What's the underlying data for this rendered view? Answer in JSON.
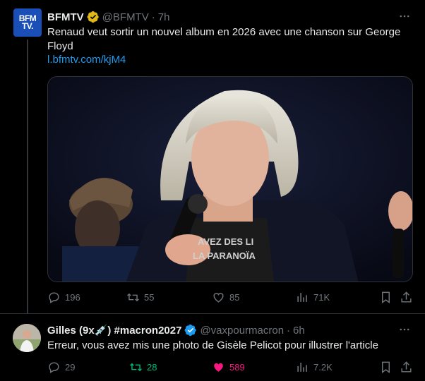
{
  "tweet1": {
    "author_name": "BFMTV",
    "handle": "@BFMTV",
    "separator": "·",
    "time": "7h",
    "avatar_text_line1": "BFM",
    "avatar_text_line2": "TV.",
    "text": "Renaud veut sortir un nouvel album en 2026 avec une chanson sur George Floyd",
    "link": "l.bfmtv.com/kjM4",
    "media_shirt_text_line1": "AVEZ DES LI",
    "media_shirt_text_line2": "LA PARANOÏA",
    "replies": "196",
    "reposts": "55",
    "likes": "85",
    "views": "71K"
  },
  "tweet2": {
    "author_name": "Gilles (9x💉) #macron2027",
    "handle": "@vaxpourmacron",
    "separator": "·",
    "time": "6h",
    "text": "Erreur, vous avez mis une photo de Gisèle Pelicot pour illustrer l'article",
    "replies": "29",
    "reposts": "28",
    "likes": "589",
    "views": "7.2K"
  },
  "colors": {
    "background": "#000000",
    "text": "#e7e9ea",
    "muted": "#71767b",
    "link": "#1d9bf0",
    "verified_gold": "#e2b719",
    "verified_blue": "#1d9bf0",
    "repost_active": "#00ba7c",
    "like_active": "#f91880"
  },
  "icons": [
    "more-icon",
    "reply-icon",
    "repost-icon",
    "like-icon",
    "views-icon",
    "bookmark-icon",
    "share-icon",
    "verified-badge-icon"
  ]
}
